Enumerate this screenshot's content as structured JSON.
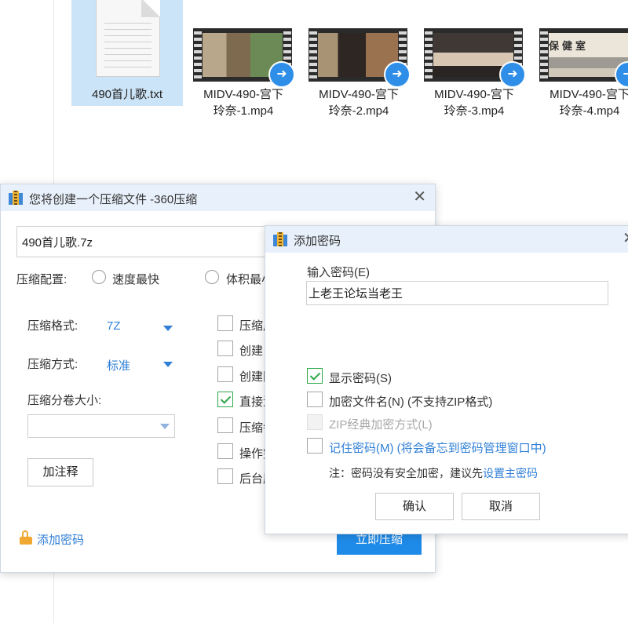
{
  "explorer": {
    "files": [
      {
        "name": "490首儿歌.txt",
        "type": "text",
        "selected": true
      },
      {
        "name_line1": "MIDV-490-宫下",
        "name_line2": "玲奈-1.mp4",
        "type": "video",
        "thumb_colors": [
          "#c9b79a",
          "#8f7a5a",
          "#6e8a54"
        ]
      },
      {
        "name_line1": "MIDV-490-宫下",
        "name_line2": "玲奈-2.mp4",
        "type": "video",
        "thumb_colors": [
          "#b3a07f",
          "#3a2f2a",
          "#9c7450"
        ]
      },
      {
        "name_line1": "MIDV-490-宫下",
        "name_line2": "玲奈-3.mp4",
        "type": "video",
        "thumb_colors": [
          "#4b4440",
          "#d9c9b5",
          "#2c2624"
        ]
      },
      {
        "name_line1": "MIDV-490-宫下",
        "name_line2": "玲奈-4.mp4",
        "type": "video",
        "thumb_text": "保健室",
        "thumb_colors": [
          "#e8e2d6",
          "#9a9a90",
          "#cfc8b8"
        ]
      }
    ]
  },
  "compress_dialog": {
    "title": "您将创建一个压缩文件 -360压缩",
    "filename": "490首儿歌.7z",
    "config_label": "压缩配置:",
    "radio_fast": "速度最快",
    "radio_small": "体积最小",
    "format_label": "压缩格式:",
    "format_value": "7Z",
    "method_label": "压缩方式:",
    "method_value": "标准",
    "split_label": "压缩分卷大小:",
    "split_value": "",
    "comment_button": "加注释",
    "options": [
      {
        "label": "压缩后删除原文件",
        "checked": false
      },
      {
        "label": "创建自解压文件",
        "checked": false
      },
      {
        "label": "创建固实压缩文件",
        "checked": false
      },
      {
        "label": "直接添加到压缩包",
        "checked": true
      },
      {
        "label": "压缩每个文件到单独的压缩包",
        "checked": false
      },
      {
        "label": "操作完成后关机",
        "checked": false
      },
      {
        "label": "后台压缩",
        "checked": false
      }
    ],
    "add_password_link": "添加密码",
    "compress_now_button": "立即压缩"
  },
  "password_dialog": {
    "title": "添加密码",
    "input_label": "输入密码(E)",
    "password_value": "上老王论坛当老王",
    "show_password": "显示密码(S)",
    "encrypt_names": "加密文件名(N) (不支持ZIP格式)",
    "zip_classic": "ZIP经典加密方式(L)",
    "remember_password": "记住密码(M) (将会备忘到密码管理窗口中)",
    "note_prefix": "注：密码没有安全加密，建议先",
    "note_link": "设置主密码",
    "ok_button": "确认",
    "cancel_button": "取消"
  },
  "colors": {
    "accent": "#2f7fd6",
    "check": "#2ea84a",
    "titlebar": "#e8f1fb",
    "primary_button": "#1f8be8"
  }
}
